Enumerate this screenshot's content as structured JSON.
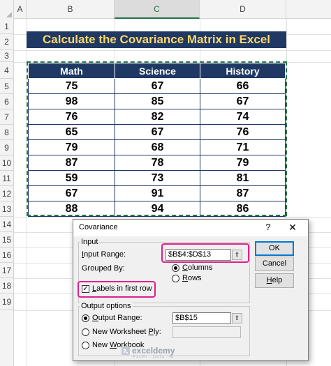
{
  "sheet": {
    "columns": [
      "A",
      "B",
      "C",
      "D"
    ],
    "rows": [
      "1",
      "2",
      "3",
      "4",
      "5",
      "6",
      "7",
      "8",
      "9",
      "10",
      "11",
      "12",
      "13",
      "14",
      "15",
      "16",
      "17",
      "18",
      "19"
    ]
  },
  "title": "Calculate the Covariance Matrix in Excel",
  "table": {
    "headers": [
      "Math",
      "Science",
      "History"
    ],
    "rows": [
      [
        "75",
        "67",
        "66"
      ],
      [
        "98",
        "85",
        "67"
      ],
      [
        "76",
        "82",
        "74"
      ],
      [
        "65",
        "67",
        "76"
      ],
      [
        "79",
        "68",
        "71"
      ],
      [
        "87",
        "78",
        "79"
      ],
      [
        "59",
        "73",
        "81"
      ],
      [
        "67",
        "91",
        "87"
      ],
      [
        "88",
        "94",
        "86"
      ]
    ]
  },
  "dialog": {
    "title": "Covariance",
    "help": "?",
    "close": "✕",
    "input_group": "Input",
    "input_range_label_pre": "",
    "input_range_label_u": "I",
    "input_range_label_post": "nput Range:",
    "input_range_value": "$B$4:$D$13",
    "grouped_by_label": "Grouped By:",
    "columns_u": "C",
    "columns_rest": "olumns",
    "rows_u": "R",
    "rows_rest": "ows",
    "labels_u": "L",
    "labels_rest": "abels in first row",
    "output_group": "Output options",
    "output_range_u": "O",
    "output_range_rest": "utput Range:",
    "output_range_value": "$B$15",
    "new_ws_pre": "New Worksheet ",
    "new_ws_u": "P",
    "new_ws_post": "ly:",
    "new_wb_pre": "New ",
    "new_wb_u": "W",
    "new_wb_post": "orkbook",
    "ok": "OK",
    "cancel": "Cancel",
    "help_btn_u": "H",
    "help_btn_rest": "elp",
    "ref_icon": "⇧"
  },
  "watermark": {
    "brand": "exceldemy",
    "tagline": "EXCEL · DATA · BI"
  },
  "colors": {
    "navy": "#1f3864",
    "title_text": "#ffd966",
    "highlight": "#e0208c",
    "excel_green": "#217346"
  }
}
